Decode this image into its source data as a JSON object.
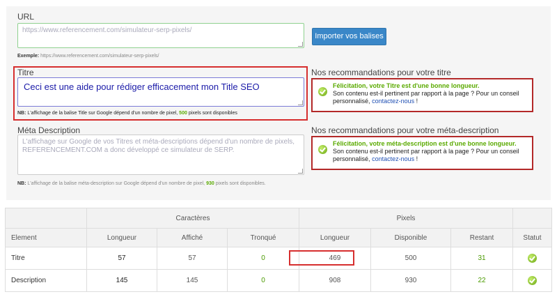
{
  "url_section": {
    "label": "URL",
    "placeholder": "https://www.referencement.com/simulateur-serp-pixels/",
    "example_label": "Exemple:",
    "example_value": "https://www.referencement.com/simulateur-serp-pixels/",
    "import_button": "Importer vos balises"
  },
  "title_section": {
    "label": "Titre",
    "value": "Ceci est une aide pour rédiger efficacement mon Title SEO",
    "note_prefix": "NB:",
    "note_text": "L'affichage de la balise Title sur Google dépend d'un nombre de pixel,",
    "note_pixels": "500",
    "note_suffix": "pixels sont disponibles"
  },
  "meta_section": {
    "label": "Méta Description",
    "placeholder": "L'affichage sur Google de vos Titres et méta-descriptions dépend d'un nombre de pixels, REFERENCEMENT.COM a donc développé ce simulateur de SERP.",
    "note_prefix": "NB:",
    "note_text": "L'affichage de la balise méta-description sur Google dépend d'un nombre de pixel,",
    "note_pixels": "930",
    "note_suffix": "pixels sont disponibles."
  },
  "title_recommendation": {
    "heading": "Nos recommandations pour votre titre",
    "strong": "Félicitation, votre Titre est d'une bonne longueur.",
    "text": "Son contenu est-il pertinent par rapport à la page ? Pour un conseil personnalisé,",
    "link": "contactez-nous",
    "end": " !"
  },
  "meta_recommendation": {
    "heading": "Nos recommandations pour votre méta-description",
    "strong": "Félicitation, votre méta-description est d'une bonne longueur.",
    "text": "Son contenu est-il pertinent par rapport à la page ? Pour un conseil personnalisé,",
    "link": "contactez-nous",
    "end": " !"
  },
  "table": {
    "group_characters": "Caractères",
    "group_pixels": "Pixels",
    "headers": [
      "Element",
      "Longueur",
      "Affiché",
      "Tronqué",
      "Longueur",
      "Disponible",
      "Restant",
      "Statut"
    ],
    "rows": [
      {
        "element": "Titre",
        "char_length": "57",
        "char_displayed": "57",
        "char_truncated": "0",
        "px_length": "469",
        "px_available": "500",
        "px_remaining": "31",
        "status": "ok"
      },
      {
        "element": "Description",
        "char_length": "145",
        "char_displayed": "145",
        "char_truncated": "0",
        "px_length": "908",
        "px_available": "930",
        "px_remaining": "22",
        "status": "ok"
      }
    ]
  },
  "colors": {
    "accent_green": "#5aaa00",
    "highlight_red": "#d62e2e",
    "button_blue": "#3a87c8",
    "link_blue": "#1f4fb3"
  }
}
